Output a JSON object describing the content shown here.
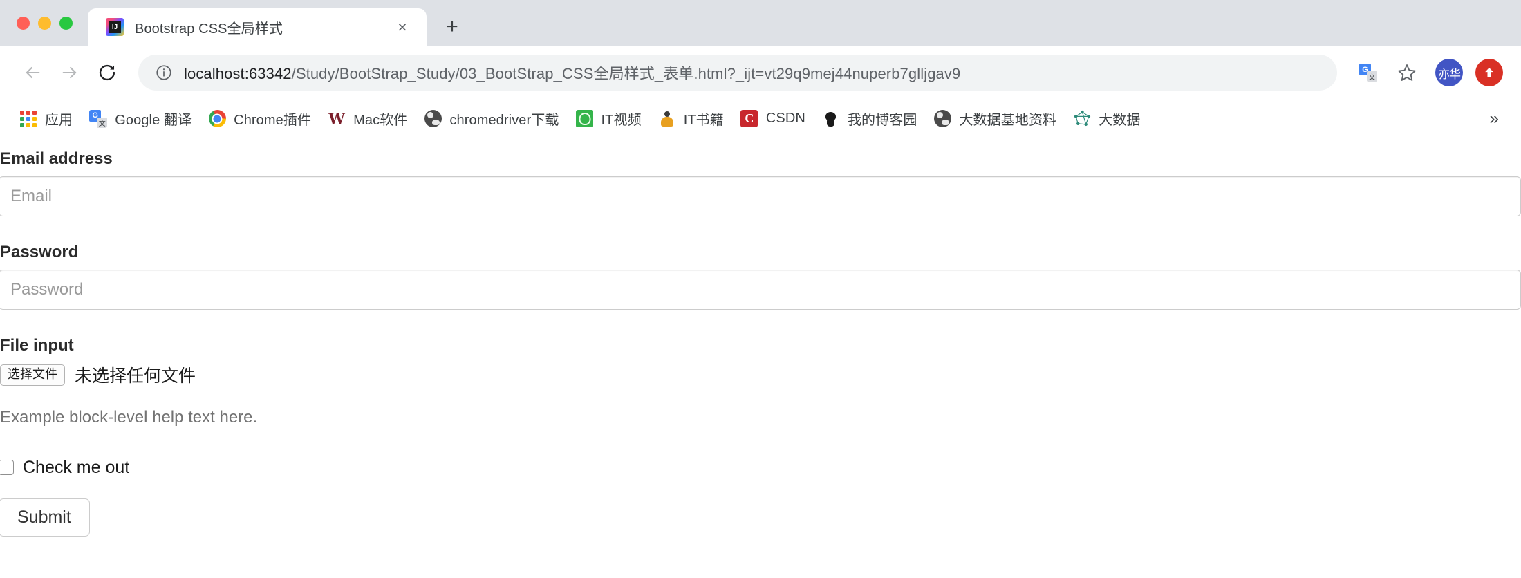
{
  "window": {
    "traffic_lights": [
      "close",
      "minimize",
      "zoom"
    ],
    "colors": {
      "close": "#ff5f57",
      "minimize": "#febc2e",
      "zoom": "#28c840",
      "tabstrip_bg": "#dee1e6",
      "active_tab_bg": "#ffffff",
      "accent": "#4285f4",
      "avatar_bg": "#4255c4",
      "update_badge_bg": "#d93025"
    }
  },
  "tabs": [
    {
      "title": "Bootstrap CSS全局样式",
      "favicon": "intellij-idea-icon",
      "active": true,
      "close_label": "×"
    }
  ],
  "new_tab_label": "+",
  "toolbar": {
    "back_label": "←",
    "forward_label": "→",
    "reload_label": "⟳",
    "url_host": "localhost:63342",
    "url_path": "/Study/BootStrap_Study/03_BootStrap_CSS全局样式_表单.html?_ijt=vt29q9mej44nuperb7glljgav9",
    "info_icon": "site-information-icon",
    "translate_icon": "google-translate-icon",
    "bookmark_icon": "star-icon",
    "avatar_text": "亦华",
    "update_icon": "update-arrow-icon"
  },
  "bookmarks": {
    "items": [
      {
        "label": "应用",
        "icon": "apps-grid-icon"
      },
      {
        "label": "Google 翻译",
        "icon": "google-translate-icon"
      },
      {
        "label": "Chrome插件",
        "icon": "chrome-logo-icon"
      },
      {
        "label": "Mac软件",
        "icon": "w-letter-icon"
      },
      {
        "label": "chromedriver下载",
        "icon": "globe-icon"
      },
      {
        "label": "IT视频",
        "icon": "green-square-icon"
      },
      {
        "label": "IT书籍",
        "icon": "person-icon"
      },
      {
        "label": "CSDN",
        "icon": "csdn-letter-c-icon"
      },
      {
        "label": "我的博客园",
        "icon": "black-cat-icon"
      },
      {
        "label": "大数据基地资料",
        "icon": "globe-icon"
      },
      {
        "label": "大数据",
        "icon": "network-graph-icon"
      }
    ],
    "overflow_label": "»"
  },
  "page": {
    "email": {
      "label": "Email address",
      "placeholder": "Email",
      "value": ""
    },
    "password": {
      "label": "Password",
      "placeholder": "Password",
      "value": ""
    },
    "file": {
      "label": "File input",
      "button_label": "选择文件",
      "status_text": "未选择任何文件",
      "help_text": "Example block-level help text here."
    },
    "checkbox": {
      "label": "Check me out",
      "checked": false
    },
    "submit": {
      "label": "Submit"
    }
  }
}
